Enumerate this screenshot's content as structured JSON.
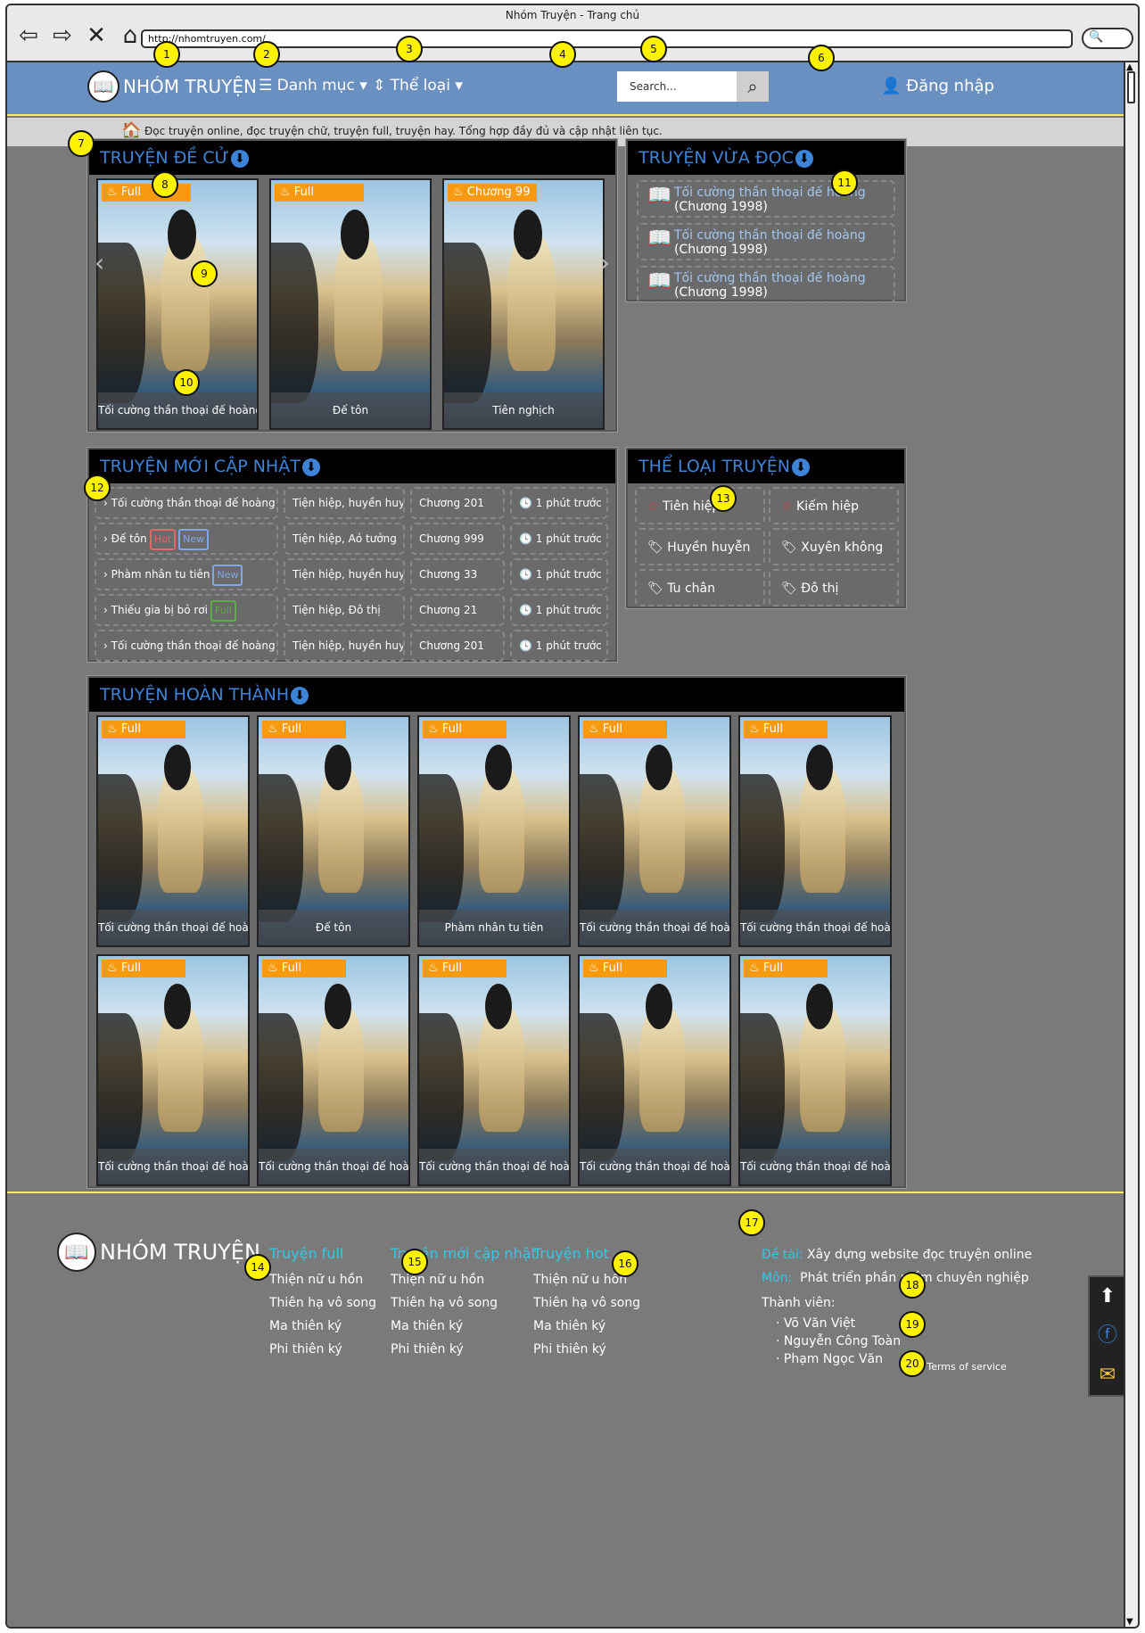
{
  "window": {
    "title": "Nhóm Truyện - Trang chủ",
    "url": "http://nhomtruyen.com/"
  },
  "nav": {
    "brand": "NHÓM TRUYỆN",
    "categories": "Danh mục",
    "genres": "Thể loại",
    "search_placeholder": "Search...",
    "login": "Đăng nhập"
  },
  "notice": "Đọc truyện online, đọc truyện chữ, truyện full, truyện hay. Tổng hợp đầy đủ và cập nhật liên tục.",
  "recommended": {
    "title": "TRUYỆN ĐỀ CỬ",
    "items": [
      {
        "badge": "Full",
        "title": "Tối cường thần thoại đế hoàng"
      },
      {
        "badge": "Full",
        "title": "Đế tôn"
      },
      {
        "badge": "Chương 99",
        "title": "Tiên nghịch"
      }
    ]
  },
  "recent": {
    "title": "TRUYỆN VỪA ĐỌC",
    "items": [
      {
        "title": "Tối cường thần thoại đế hoàng",
        "chapter": "(Chương 1998)"
      },
      {
        "title": "Tối cường thần thoại đế hoàng",
        "chapter": "(Chương 1998)"
      },
      {
        "title": "Tối cường thần thoại đế hoàng",
        "chapter": "(Chương 1998)"
      }
    ]
  },
  "updates": {
    "title": "TRUYỆN MỚI CẬP NHẬT",
    "rows": [
      {
        "name": "Tối cường thần thoại đế hoàng",
        "genre": "Tiện hiệp, huyền huyễn",
        "chapter": "Chương 201",
        "time": "1 phút trước",
        "tags": []
      },
      {
        "name": "Đế tôn",
        "genre": "Tiện hiệp, Aỏ tưởng",
        "chapter": "Chương 999",
        "time": "1 phút trước",
        "tags": [
          "Hot",
          "New"
        ]
      },
      {
        "name": "Phàm nhân tu tiên",
        "genre": "Tiện hiệp, huyền huyễn",
        "chapter": "Chương 33",
        "time": "1 phút trước",
        "tags": [
          "New"
        ]
      },
      {
        "name": "Thiếu gia bị bỏ rơi",
        "genre": "Tiện hiệp, Đô thị",
        "chapter": "Chương 21",
        "time": "1 phút trước",
        "tags": [
          "Full"
        ]
      },
      {
        "name": "Tối cường thần thoại đế hoàng",
        "genre": "Tiện hiệp, huyền huyễn",
        "chapter": "Chương 201",
        "time": "1 phút trước",
        "tags": []
      }
    ]
  },
  "genres": {
    "title": "THỂ LOẠI TRUYỆN",
    "items": [
      "Tiên hiệp",
      "Kiếm hiệp",
      "Huyền huyễn",
      "Xuyên không",
      "Tu chân",
      "Đô thị"
    ]
  },
  "completed": {
    "title": "TRUYỆN HOÀN THÀNH",
    "items": [
      {
        "badge": "Full",
        "title": "Tối cường thần thoại đế hoàng"
      },
      {
        "badge": "Full",
        "title": "Đế tôn"
      },
      {
        "badge": "Full",
        "title": "Phàm nhân tu tiên"
      },
      {
        "badge": "Full",
        "title": "Tối cường thần thoại đế hoàng"
      },
      {
        "badge": "Full",
        "title": "Tối cường thần thoại đế hoàng"
      },
      {
        "badge": "Full",
        "title": "Tối cường thần thoại đế hoàng"
      },
      {
        "badge": "Full",
        "title": "Tối cường thần thoại đế hoàng"
      },
      {
        "badge": "Full",
        "title": "Tối cường thần thoại đế hoàng"
      },
      {
        "badge": "Full",
        "title": "Tối cường thần thoại đế hoàng"
      },
      {
        "badge": "Full",
        "title": "Tối cường thần thoại đế hoàng"
      }
    ]
  },
  "footer": {
    "brand": "NHÓM TRUYỆN",
    "cols": [
      {
        "heading": "Truyện full",
        "items": [
          "Thiện nữ u hồn",
          "Thiên hạ vô song",
          "Ma thiên ký",
          "Phi thiên ký"
        ]
      },
      {
        "heading": "Truyện mới cập nhật",
        "items": [
          "Thiện nữ u hồn",
          "Thiên hạ vô song",
          "Ma thiên ký",
          "Phi thiên ký"
        ]
      },
      {
        "heading": "Truyện hot",
        "items": [
          "Thiện nữ u hồn",
          "Thiên hạ vô song",
          "Ma thiên ký",
          "Phi thiên ký"
        ]
      }
    ],
    "topic_label": "Đề tài:",
    "topic": "Xây dựng website đọc truyện online",
    "subject_label": "Môn:",
    "subject": "Phát triển phần mềm chuyên nghiệp",
    "members_label": "Thành viên:",
    "members": [
      "Võ Văn Việt",
      "Nguyễn Công Toàn",
      "Phạm Ngọc Văn"
    ],
    "terms": "Terms of service"
  },
  "badge_numbers": [
    "1",
    "2",
    "3",
    "4",
    "5",
    "6",
    "7",
    "8",
    "9",
    "10",
    "11",
    "12",
    "13",
    "14",
    "15",
    "16",
    "17",
    "18",
    "19",
    "20"
  ],
  "colors": {
    "nav": "#6a8fc1",
    "accent": "#3d84d9",
    "badge": "#f89a10",
    "footer_heading": "#35c7e6",
    "marker": "#fff200"
  }
}
